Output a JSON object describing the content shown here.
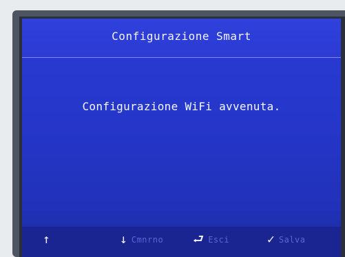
{
  "screen": {
    "title": "Configurazione Smart",
    "message": "Configurazione WiFi avvenuta."
  },
  "footer": {
    "keys": [
      {
        "icon": "↑",
        "label": ""
      },
      {
        "icon": "↓",
        "label": "Cmnrno"
      },
      {
        "icon": "⮐",
        "label": "Esci"
      },
      {
        "icon": "✓",
        "label": "Salva"
      }
    ]
  }
}
